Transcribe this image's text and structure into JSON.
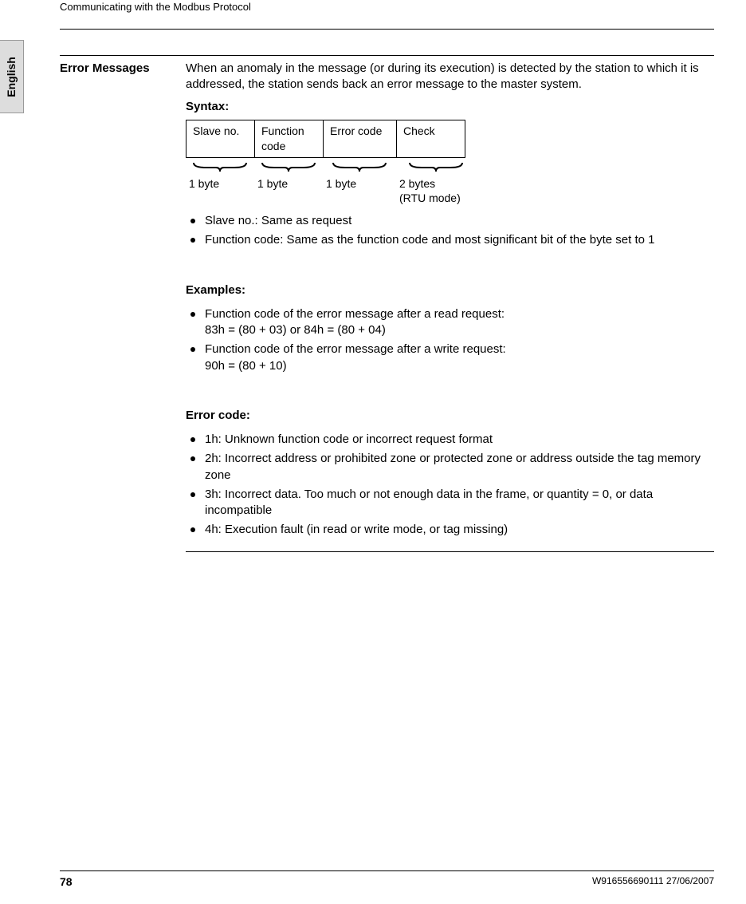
{
  "header": {
    "running_head": "Communicating with the Modbus Protocol",
    "side_tab": "English"
  },
  "section": {
    "heading": "Error Messages",
    "intro": "When an anomaly in the message (or during its execution) is detected by the station to which it is addressed, the station sends back an error message to the master system.",
    "syntax_label": "Syntax:",
    "table": {
      "c1": "Slave no.",
      "c2": "Function code",
      "c3": "Error code",
      "c4": "Check"
    },
    "bytes": {
      "b1": "1 byte",
      "b2": "1 byte",
      "b3": "1 byte",
      "b4": "2 bytes\n(RTU mode)"
    },
    "list1": [
      "Slave no.: Same as request",
      "Function code: Same as the function code and most significant bit of the byte set to 1"
    ],
    "examples_label": "Examples:",
    "list2": [
      "Function code of the error message after a read request:\n83h = (80 + 03) or 84h = (80 + 04)",
      "Function code of the error message after a write request:\n90h = (80 + 10)"
    ],
    "errcode_label": "Error code:",
    "list3": [
      "1h: Unknown function code or incorrect request format",
      "2h: Incorrect address or prohibited zone or protected zone or address outside the tag memory zone",
      "3h: Incorrect data. Too much or not enough data in the frame, or quantity = 0, or data incompatible",
      "4h: Execution fault (in read or write mode, or tag missing)"
    ]
  },
  "footer": {
    "page_number": "78",
    "doc_id": "W916556690111 27/06/2007"
  }
}
